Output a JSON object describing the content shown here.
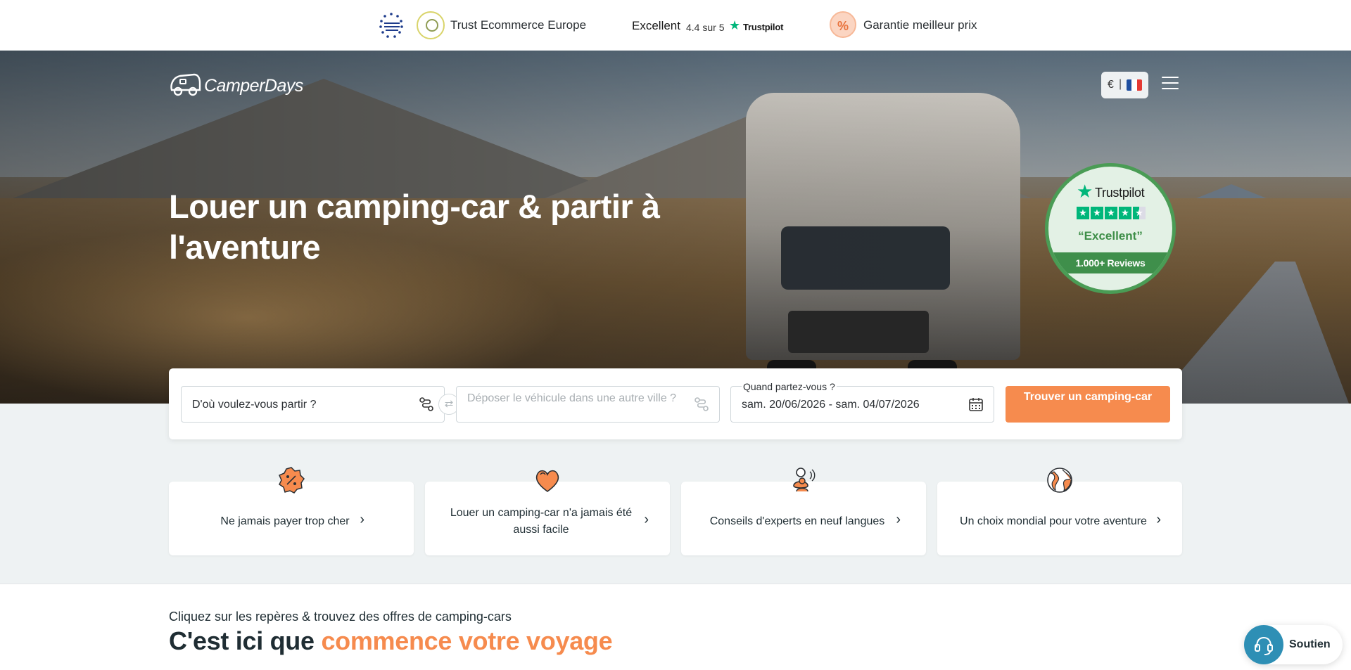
{
  "trustbar": {
    "eu_logo_text": "TRUST ECOMMERCE EUROPE",
    "trust_label": "Trust Ecommerce Europe",
    "rating_word": "Excellent",
    "rating_score": "4.4 sur 5",
    "rating_brand": "Trustpilot",
    "percent_symbol": "%",
    "garantie_label": "Garantie meilleur prix"
  },
  "header": {
    "logo_text": "CamperDays",
    "currency": "€",
    "separator": "|",
    "flag_colors": [
      "#1f4fa0",
      "#ffffff",
      "#e53a34"
    ],
    "menu_icon": "hamburger-menu-icon"
  },
  "hero": {
    "title": "Louer un camping-car & partir à l'aventure"
  },
  "trustpilot_badge": {
    "brand": "Trustpilot",
    "rating_stars": 4.5,
    "quote": "“Excellent”",
    "reviews": "1.000+ Reviews"
  },
  "search": {
    "from_value": "D'où voulez-vous partir ?",
    "to_placeholder": "Déposer le véhicule dans une autre ville ?",
    "date_label": "Quand partez-vous ?",
    "date_value": "sam. 20/06/2026 - sam. 04/07/2026",
    "submit_label": "Trouver un camping-car"
  },
  "features": [
    {
      "label": "Ne jamais payer trop cher",
      "icon": "percent-badge-icon"
    },
    {
      "label": "Louer un camping-car n'a jamais été aussi facile",
      "icon": "heart-icon"
    },
    {
      "label": "Conseils d'experts en neuf langues",
      "icon": "people-icon"
    },
    {
      "label": "Un choix mondial pour votre aventure",
      "icon": "globe-icon"
    }
  ],
  "map_section": {
    "kicker": "Cliquez sur les repères & trouvez des offres de camping-cars",
    "title_plain": "C'est ici que ",
    "title_accent": "commence votre voyage"
  },
  "support": {
    "label": "Soutien"
  },
  "colors": {
    "accent": "#f68b4e",
    "trustpilot_green": "#00b67a",
    "badge_green": "#3f8f4b",
    "support_blue": "#2e8fb5"
  }
}
